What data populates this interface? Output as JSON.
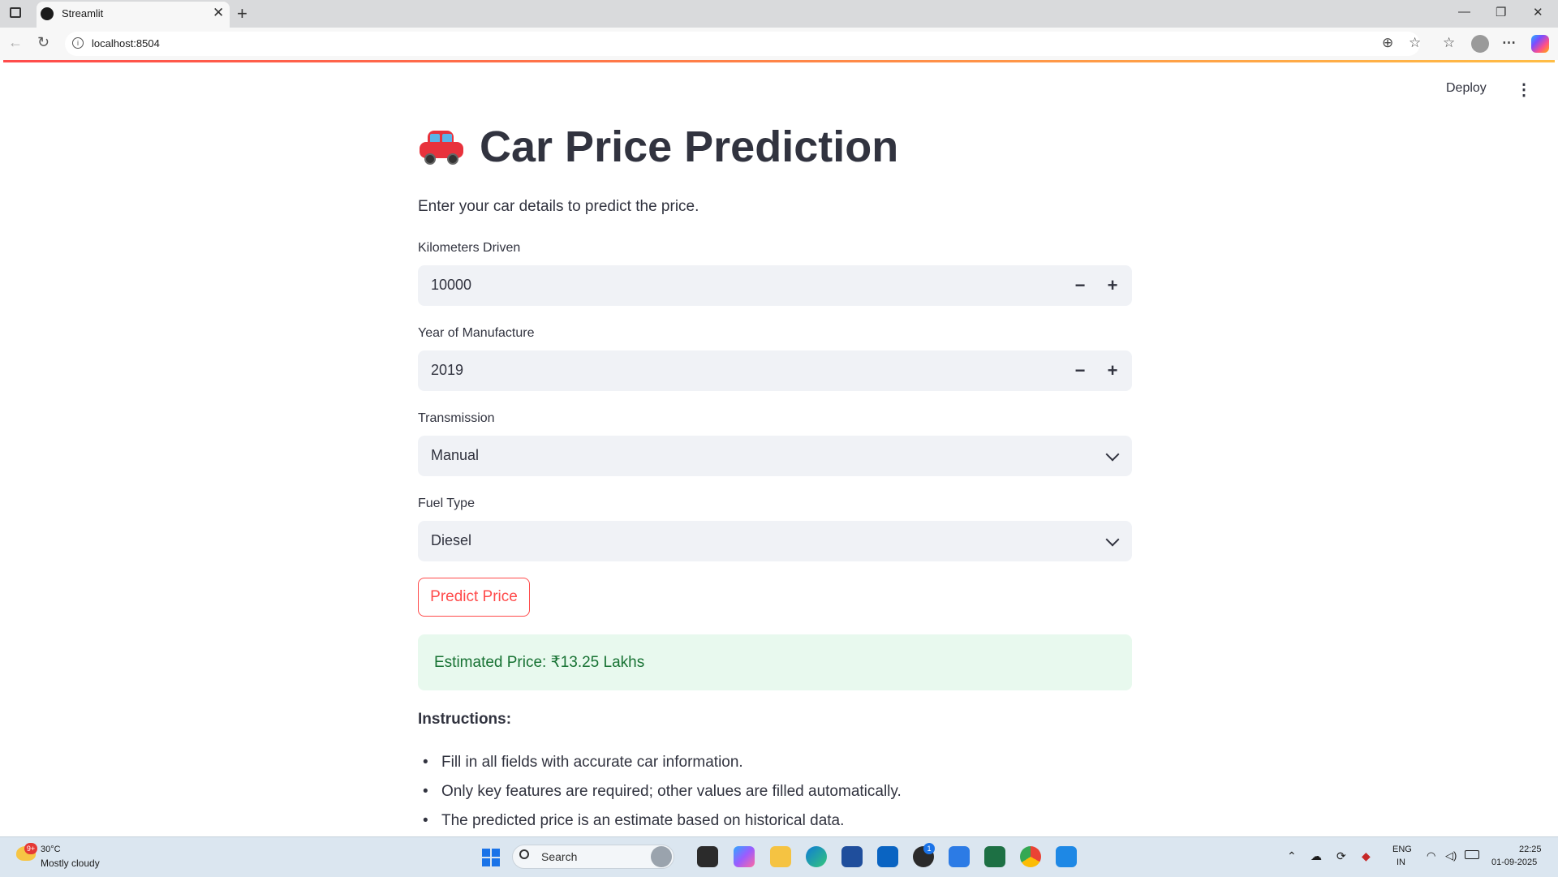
{
  "browser": {
    "tab_title": "Streamlit",
    "url": "localhost:8504"
  },
  "header": {
    "deploy_label": "Deploy"
  },
  "main": {
    "title": "Car Price Prediction",
    "subtitle": "Enter your car details to predict the price.",
    "fields": [
      {
        "label": "Kilometers Driven",
        "value": "10000",
        "type": "number"
      },
      {
        "label": "Year of Manufacture",
        "value": "2019",
        "type": "number"
      },
      {
        "label": "Transmission",
        "value": "Manual",
        "type": "select"
      },
      {
        "label": "Fuel Type",
        "value": "Diesel",
        "type": "select"
      }
    ],
    "predict_button": "Predict Price",
    "result": "Estimated Price: ₹13.25 Lakhs",
    "instructions_heading": "Instructions:",
    "instructions": [
      "Fill in all fields with accurate car information.",
      "Only key features are required; other values are filled automatically.",
      "The predicted price is an estimate based on historical data."
    ]
  },
  "taskbar": {
    "weather_temp": "30°C",
    "weather_desc": "Mostly cloudy",
    "weather_badge": "9+",
    "search_placeholder": "Search",
    "language": "ENG",
    "region": "IN",
    "time": "22:25",
    "date": "01-09-2025",
    "whatsapp_badge": "1"
  },
  "colors": {
    "accent": "#ff4b4b",
    "success_bg": "#e8f9ee",
    "success_text": "#177233",
    "input_bg": "#f0f2f6"
  }
}
